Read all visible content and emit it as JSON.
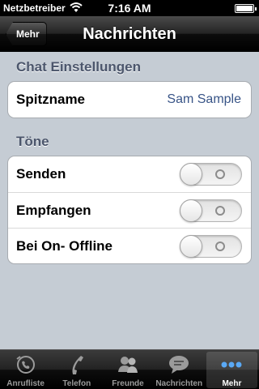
{
  "status_bar": {
    "carrier": "Netzbetreiber",
    "time": "7:16 AM"
  },
  "nav": {
    "back_label": "Mehr",
    "title": "Nachrichten"
  },
  "sections": {
    "chat": {
      "header": "Chat Einstellungen",
      "nickname_label": "Spitzname",
      "nickname_value": "Sam Sample"
    },
    "sounds": {
      "header": "Töne",
      "rows": [
        {
          "label": "Senden",
          "state": "off"
        },
        {
          "label": "Empfangen",
          "state": "off"
        },
        {
          "label": "Bei On- Offline",
          "state": "off"
        }
      ]
    }
  },
  "tab_bar": {
    "tabs": [
      {
        "label": "Anrufliste",
        "icon": "call-log-icon"
      },
      {
        "label": "Telefon",
        "icon": "phone-handset-icon"
      },
      {
        "label": "Freunde",
        "icon": "friends-icon"
      },
      {
        "label": "Nachrichten",
        "icon": "chat-bubble-icon"
      },
      {
        "label": "Mehr",
        "icon": "more-dots-icon"
      }
    ],
    "active_index": 4
  },
  "colors": {
    "background": "#c5ccd4",
    "section_header": "#4c566c",
    "value_text": "#385487"
  }
}
